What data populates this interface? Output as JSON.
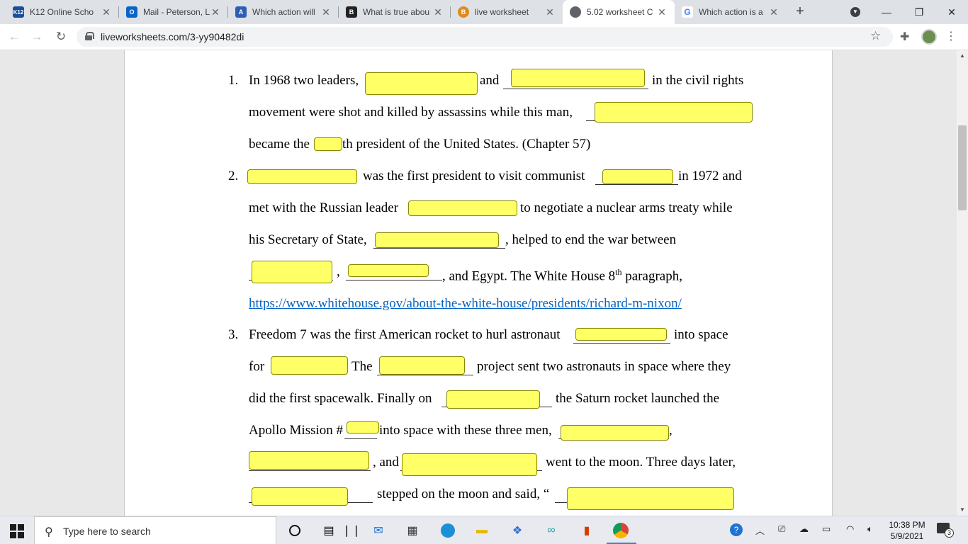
{
  "browser": {
    "tabs": [
      {
        "title": "K12 Online Scho",
        "favicon": "K12"
      },
      {
        "title": "Mail - Peterson, L",
        "favicon": "O"
      },
      {
        "title": "Which action will",
        "favicon": "A"
      },
      {
        "title": "What is true abou",
        "favicon": "B"
      },
      {
        "title": "live worksheet",
        "favicon": "B"
      },
      {
        "title": "5.02 worksheet C",
        "favicon": ""
      },
      {
        "title": "Which action is a",
        "favicon": "G"
      }
    ],
    "url": "liveworksheets.com/3-yy90482di"
  },
  "worksheet": {
    "q1": {
      "number": "1.",
      "l1a": "In 1968 two leaders,",
      "l1b": "and",
      "l1c": "in the civil rights",
      "l2a": "movement were shot and killed by assassins while this man,",
      "l3a": "became the",
      "l3b": "th president of the United States. (Chapter 57)"
    },
    "q2": {
      "number": "2.",
      "l1a": "was the first president to visit communist",
      "l1b": "in 1972 and",
      "l2a": "met with the Russian leader",
      "l2b": "to negotiate a nuclear arms treaty while",
      "l3a": "his Secretary of State,",
      "l3b": ", helped to end the war between",
      "l4a": ",",
      "l4b": ", and Egypt. The White House 8",
      "l4sup": "th",
      "l4c": " paragraph,",
      "link": "https://www.whitehouse.gov/about-the-white-house/presidents/richard-m-nixon/"
    },
    "q3": {
      "number": "3.",
      "l1a": "Freedom 7 was the first American rocket to hurl astronaut",
      "l1b": "into space",
      "l2a": "for",
      "l2b": "The",
      "l2c": "project sent two astronauts in space where they",
      "l3a": "did the first spacewalk. Finally on",
      "l3b": "the Saturn rocket launched the",
      "l4a": "Apollo Mission #",
      "l4b": "into space with these three men,",
      "l4c": ",",
      "l5a": ", and",
      "l5b": "went to the moon. Three days later,",
      "l6a": "stepped on the moon and said, “"
    }
  },
  "taskbar": {
    "search_placeholder": "Type here to search",
    "time": "10:38 PM",
    "date": "5/9/2021",
    "notifications": "3"
  },
  "colors": {
    "blank_fill": "#ffff66",
    "link": "#0563c1"
  }
}
